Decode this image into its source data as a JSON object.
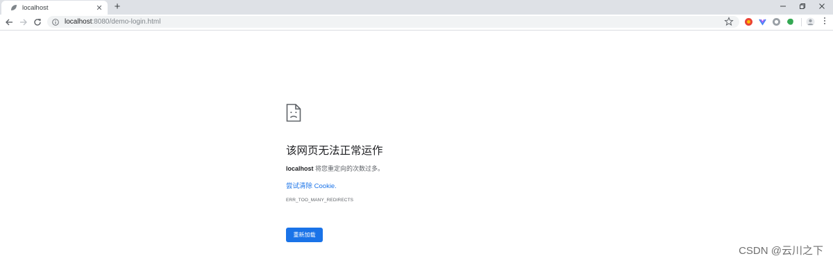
{
  "tab": {
    "title": "localhost",
    "close_glyph": "✕",
    "favicon": "page-favicon",
    "newtab_glyph": "+"
  },
  "window_controls": {
    "minimize_icon": "minimize-icon",
    "maximize_icon": "restore-icon",
    "close_icon": "close-icon"
  },
  "toolbar": {
    "back_icon": "arrow-left-icon",
    "forward_icon": "arrow-right-icon",
    "reload_icon": "reload-icon",
    "url_host": "localhost",
    "url_path": ":8080/demo-login.html",
    "bookmark_icon": "star-icon",
    "extensions": [
      {
        "name": "extension-red-icon",
        "color": "#ea4335"
      },
      {
        "name": "extension-blue-icon",
        "color": "#4285f4"
      },
      {
        "name": "extension-gray-icon",
        "color": "#9aa0a6"
      },
      {
        "name": "extension-green-icon",
        "color": "#34a853"
      },
      {
        "name": "profile-avatar-icon",
        "color": "#bdc1c6"
      }
    ]
  },
  "error": {
    "icon": "sad-document-icon",
    "heading": "该网页无法正常运作",
    "host_bold": "localhost",
    "message_rest": " 将您重定向的次数过多。",
    "link_text": "尝试清除 Cookie.",
    "error_code": "ERR_TOO_MANY_REDIRECTS",
    "reload_label": "重新加载"
  },
  "colors": {
    "accent": "#1a73e8",
    "tabstrip_bg": "#dee1e6",
    "omnibox_bg": "#f1f3f4"
  },
  "watermark": "CSDN @云川之下"
}
